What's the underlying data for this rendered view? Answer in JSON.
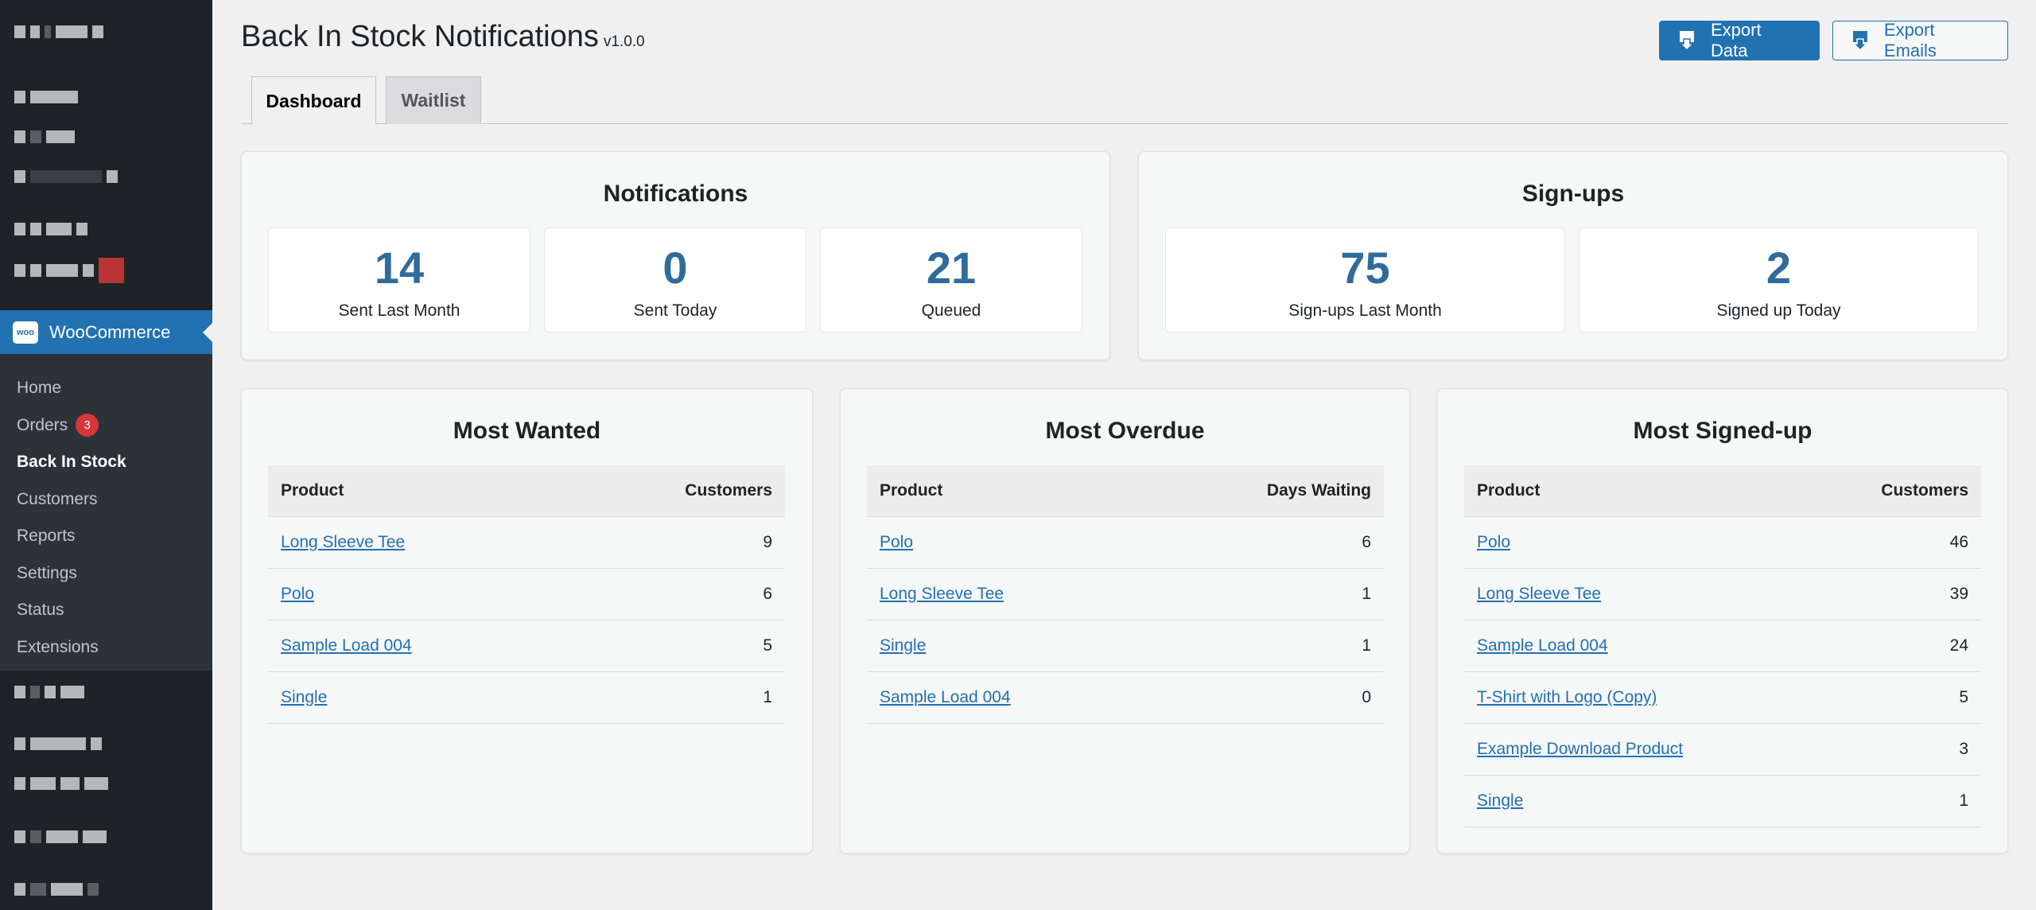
{
  "sidebar": {
    "woo_label": "WooCommerce",
    "woo_logo_text": "woo",
    "submenu": [
      {
        "label": "Home"
      },
      {
        "label": "Orders",
        "badge": "3"
      },
      {
        "label": "Back In Stock"
      },
      {
        "label": "Customers"
      },
      {
        "label": "Reports"
      },
      {
        "label": "Settings"
      },
      {
        "label": "Status"
      },
      {
        "label": "Extensions"
      }
    ]
  },
  "header": {
    "title": "Back In Stock Notifications",
    "version": "v1.0.0",
    "export_data": "Export Data",
    "export_emails": "Export Emails"
  },
  "tabs": [
    {
      "label": "Dashboard",
      "active": true
    },
    {
      "label": "Waitlist",
      "active": false
    }
  ],
  "notifications": {
    "title": "Notifications",
    "stats": [
      {
        "value": "14",
        "label": "Sent Last Month"
      },
      {
        "value": "0",
        "label": "Sent Today"
      },
      {
        "value": "21",
        "label": "Queued"
      }
    ]
  },
  "signups": {
    "title": "Sign-ups",
    "stats": [
      {
        "value": "75",
        "label": "Sign-ups Last Month"
      },
      {
        "value": "2",
        "label": "Signed up Today"
      }
    ]
  },
  "most_wanted": {
    "title": "Most Wanted",
    "columns": [
      "Product",
      "Customers"
    ],
    "rows": [
      {
        "product": "Long Sleeve Tee",
        "value": "9"
      },
      {
        "product": "Polo",
        "value": "6"
      },
      {
        "product": "Sample Load 004",
        "value": "5"
      },
      {
        "product": "Single",
        "value": "1"
      }
    ]
  },
  "most_overdue": {
    "title": "Most Overdue",
    "columns": [
      "Product",
      "Days Waiting"
    ],
    "rows": [
      {
        "product": "Polo",
        "value": "6"
      },
      {
        "product": "Long Sleeve Tee",
        "value": "1"
      },
      {
        "product": "Single",
        "value": "1"
      },
      {
        "product": "Sample Load 004",
        "value": "0"
      }
    ]
  },
  "most_signed_up": {
    "title": "Most Signed-up",
    "columns": [
      "Product",
      "Customers"
    ],
    "rows": [
      {
        "product": "Polo",
        "value": "46"
      },
      {
        "product": "Long Sleeve Tee",
        "value": "39"
      },
      {
        "product": "Sample Load 004",
        "value": "24"
      },
      {
        "product": "T-Shirt with Logo (Copy)",
        "value": "5"
      },
      {
        "product": "Example Download Product",
        "value": "3"
      },
      {
        "product": "Single",
        "value": "1"
      }
    ]
  },
  "colors": {
    "accent": "#2271b1",
    "stat_number": "#2f6c9b",
    "sidebar_bg": "#1d2327",
    "badge": "#d63638"
  },
  "icons": {
    "export": "download-arrow-icon"
  }
}
